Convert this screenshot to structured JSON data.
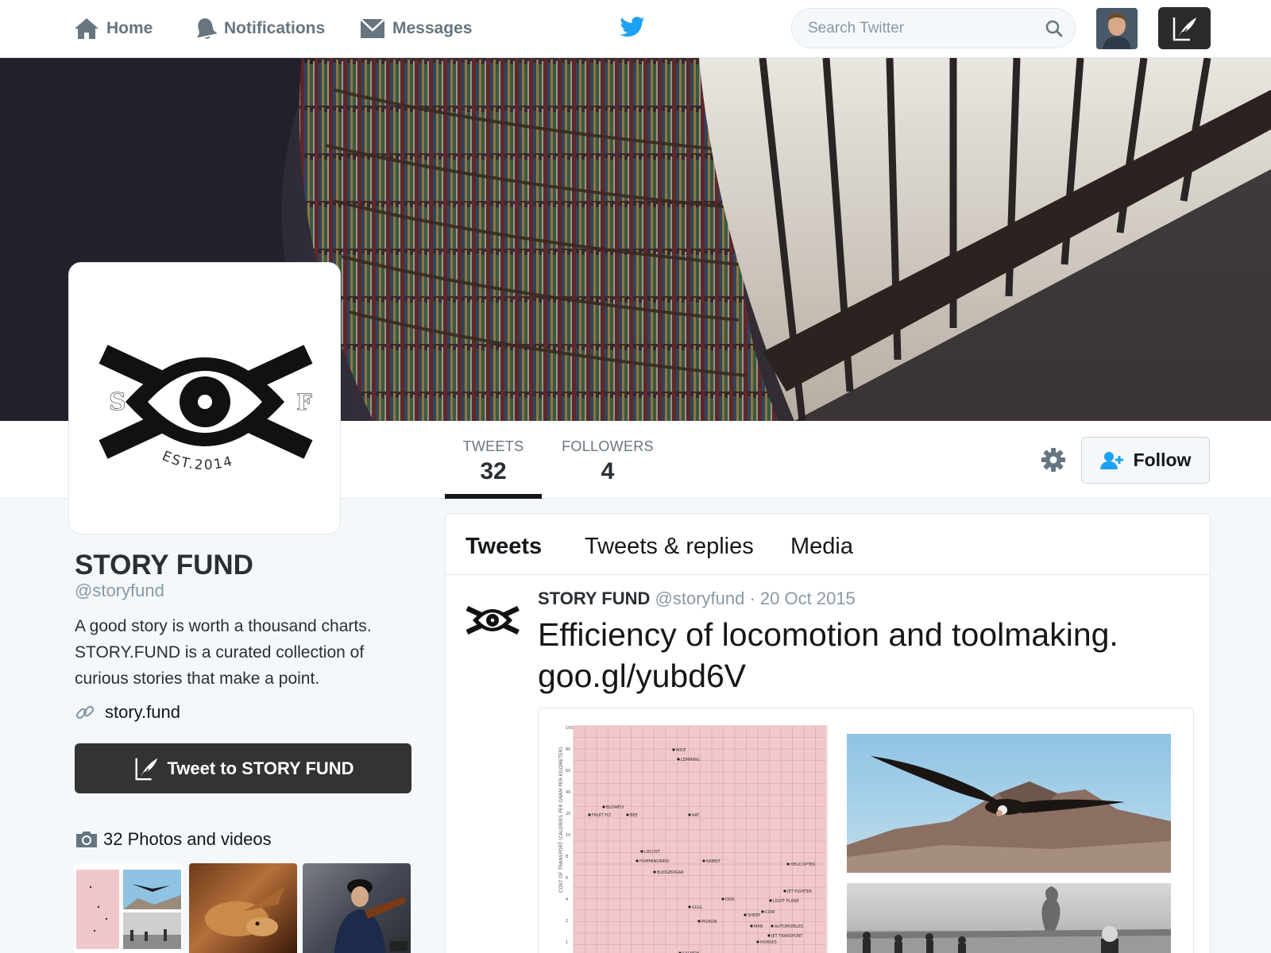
{
  "nav": {
    "home": "Home",
    "notifications": "Notifications",
    "messages": "Messages",
    "search_placeholder": "Search Twitter"
  },
  "profile": {
    "name": "STORY FUND",
    "handle": "@storyfund",
    "bio": [
      "A good story is worth a thousand charts.",
      "STORY.FUND is a curated collection of",
      "curious stories that make a point."
    ],
    "website": "story.fund",
    "logo": {
      "left": "S",
      "right": "F",
      "est": "EST.2014"
    }
  },
  "stats": {
    "tweets_label": "TWEETS",
    "tweets_value": "32",
    "followers_label": "FOLLOWERS",
    "followers_value": "4"
  },
  "actions": {
    "follow": "Follow",
    "tweet_to": "Tweet to STORY FUND"
  },
  "media_header": "32 Photos and videos",
  "tabs": [
    "Tweets",
    "Tweets & replies",
    "Media"
  ],
  "tweet": {
    "name": "STORY FUND",
    "handle": "@storyfund",
    "separator": "·",
    "date": "20 Oct 2015",
    "text_line1": "Efficiency of locomotion and toolmaking.",
    "text_line2": "goo.gl/yubd6V"
  },
  "tweet_chart": {
    "ylabel": "COST OF TRANSPORT (CALORIES PER GRAM PER KILOMETER)",
    "yticks": [
      "100",
      "80",
      "60",
      "40",
      "20",
      "10",
      "8",
      "6",
      "4",
      "2",
      "1"
    ],
    "labels": [
      "MICE",
      "LEMMING",
      "BLOWFLY",
      "FRUIT FLY",
      "BEE",
      "RAT",
      "LOCUST",
      "HUMMINGBIRD",
      "RABBIT",
      "BUDGERIGAR",
      "HELICOPTER",
      "JET FIGHTER",
      "DOG",
      "LIGHT PLANE",
      "GULL",
      "SHEEP",
      "COW",
      "PIGEON",
      "MAN",
      "AUTOMOBILES",
      "JET TRANSPORT",
      "HORSES",
      "SALMON"
    ]
  },
  "colors": {
    "accent": "#1da1f2",
    "dark_button": "#333333",
    "chart_paper": "#f0c8cc"
  }
}
